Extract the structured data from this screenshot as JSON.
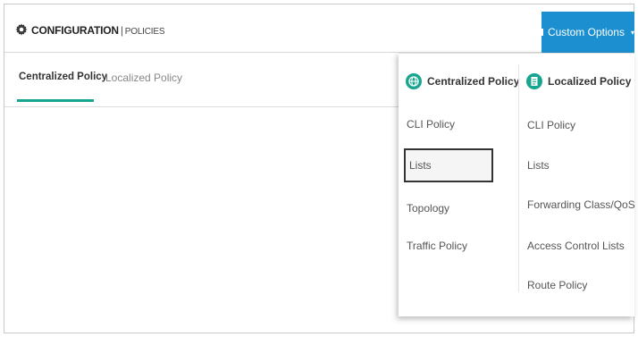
{
  "header": {
    "title": "CONFIGURATION",
    "separator": "|",
    "subtitle": "POLICIES",
    "icon": "gear-icon",
    "custom_options_label": "Custom Options",
    "custom_options_caret": "▾",
    "accent_color": "#1b8fd0"
  },
  "tabs": [
    {
      "label": "Centralized Policy",
      "active": true
    },
    {
      "label": "Localized Policy",
      "active": false
    }
  ],
  "tab_underline_color": "#18a58f",
  "dropdown": {
    "centralized": {
      "heading": "Centralized Policy",
      "icon": "globe-icon",
      "items": [
        "CLI Policy",
        "Lists",
        "Topology",
        "Traffic Policy"
      ],
      "highlighted": "Lists"
    },
    "localized": {
      "heading": "Localized Policy",
      "icon": "document-icon",
      "items": [
        "CLI Policy",
        "Lists",
        "Forwarding Class/QoS",
        "Access Control Lists",
        "Route Policy"
      ]
    }
  }
}
